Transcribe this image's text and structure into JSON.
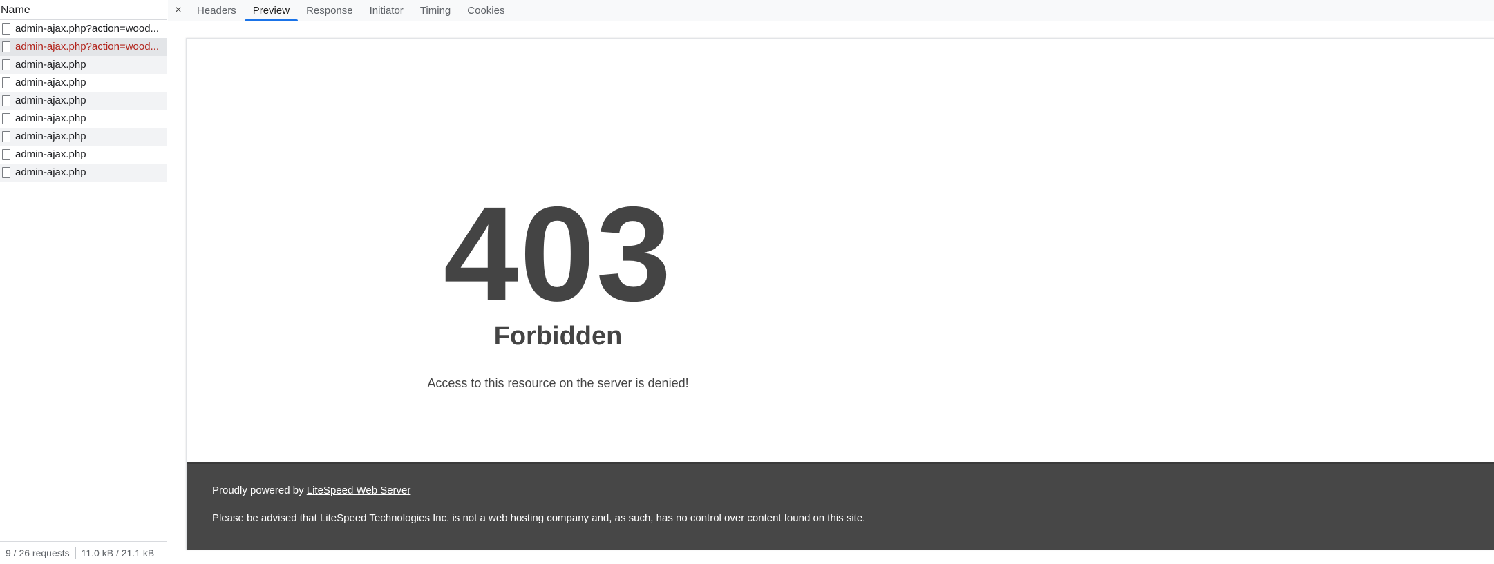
{
  "request_list": {
    "column_header": "Name",
    "items": [
      {
        "name": "admin-ajax.php?action=wood...",
        "state": "normal"
      },
      {
        "name": "admin-ajax.php?action=wood...",
        "state": "error-selected"
      },
      {
        "name": "admin-ajax.php",
        "state": "normal"
      },
      {
        "name": "admin-ajax.php",
        "state": "normal"
      },
      {
        "name": "admin-ajax.php",
        "state": "normal"
      },
      {
        "name": "admin-ajax.php",
        "state": "normal"
      },
      {
        "name": "admin-ajax.php",
        "state": "normal"
      },
      {
        "name": "admin-ajax.php",
        "state": "normal"
      },
      {
        "name": "admin-ajax.php",
        "state": "normal"
      }
    ],
    "status": {
      "requests": "9 / 26 requests",
      "transfer": "11.0 kB / 21.1 kB"
    }
  },
  "detail": {
    "close_icon": "×",
    "tabs": [
      {
        "label": "Headers",
        "active": false
      },
      {
        "label": "Preview",
        "active": true
      },
      {
        "label": "Response",
        "active": false
      },
      {
        "label": "Initiator",
        "active": false
      },
      {
        "label": "Timing",
        "active": false
      },
      {
        "label": "Cookies",
        "active": false
      }
    ],
    "accent_color": "#1a73e8"
  },
  "preview": {
    "code": "403",
    "title": "Forbidden",
    "description": "Access to this resource on the server is denied!",
    "footer": {
      "powered_prefix": "Proudly powered by",
      "powered_link": "LiteSpeed Web Server",
      "notice": "Please be advised that LiteSpeed Technologies Inc. is not a web hosting company and, as such, has no control over content found on this site."
    },
    "text_color": "#444444",
    "footer_bg": "#474747"
  }
}
